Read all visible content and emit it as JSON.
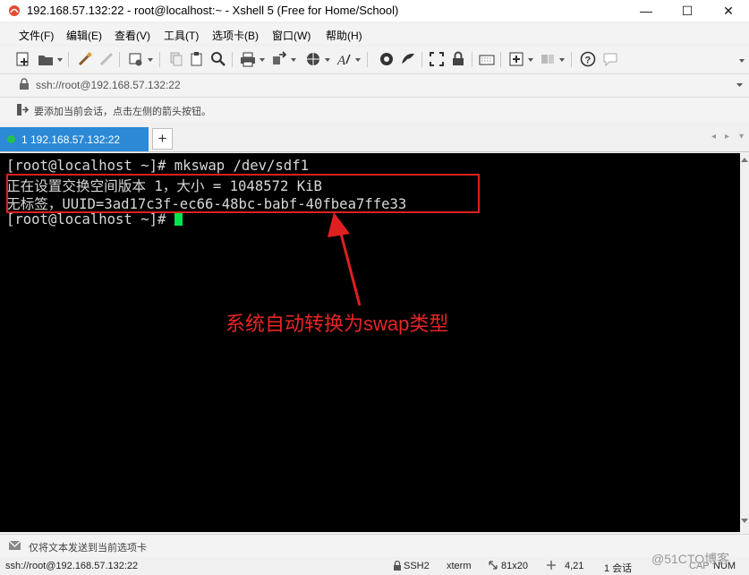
{
  "window": {
    "title": "192.168.57.132:22 - root@localhost:~ - Xshell 5 (Free for Home/School)",
    "minimize": "—",
    "maximize": "☐",
    "close": "✕"
  },
  "menu": [
    "文件(F)",
    "编辑(E)",
    "查看(V)",
    "工具(T)",
    "选项卡(B)",
    "窗口(W)",
    "帮助(H)"
  ],
  "address": {
    "value": "ssh://root@192.168.57.132:22"
  },
  "hint": {
    "text": "要添加当前会话，点击左侧的箭头按钮。"
  },
  "tabs": [
    {
      "label": "1 192.168.57.132:22",
      "active": true
    }
  ],
  "tab_add": "+",
  "terminal": {
    "lines": [
      "[root@localhost ~]# mkswap /dev/sdf1",
      "正在设置交换空间版本 1，大小 = 1048572 KiB",
      "无标签，UUID=3ad17c3f-ec66-48bc-babf-40fbea7ffe33",
      "[root@localhost ~]# "
    ],
    "cursor_color": "#00e64d",
    "background": "#000000",
    "foreground": "#d8d8d8"
  },
  "annotation": {
    "text": "系统自动转换为swap类型",
    "color": "#e82525"
  },
  "send_bar": {
    "text": "仅将文本发送到当前选项卡"
  },
  "status": {
    "connection": "ssh://root@192.168.57.132:22",
    "protocol": "SSH2",
    "terminal_type": "xterm",
    "size": "81x20",
    "cursor_pos": "4,21",
    "sessions": "1 会话",
    "caps": "CAP",
    "num": "NUM"
  },
  "watermark": "@51CTO博客",
  "icons": [
    "new-session-icon",
    "open-folder-icon",
    "connect-icon",
    "disconnect-icon",
    "properties-icon",
    "copy-icon",
    "paste-icon",
    "find-icon",
    "print-icon",
    "transfer-icon",
    "globe-icon",
    "font-icon",
    "xftp-icon",
    "xagent-icon",
    "fullscreen-icon",
    "lock-icon",
    "keyboard-icon",
    "new-tab-icon",
    "layout-icon",
    "help-icon",
    "chat-icon"
  ],
  "colors": {
    "tab_active": "#2b89d6",
    "annotation_red": "#e02020"
  }
}
